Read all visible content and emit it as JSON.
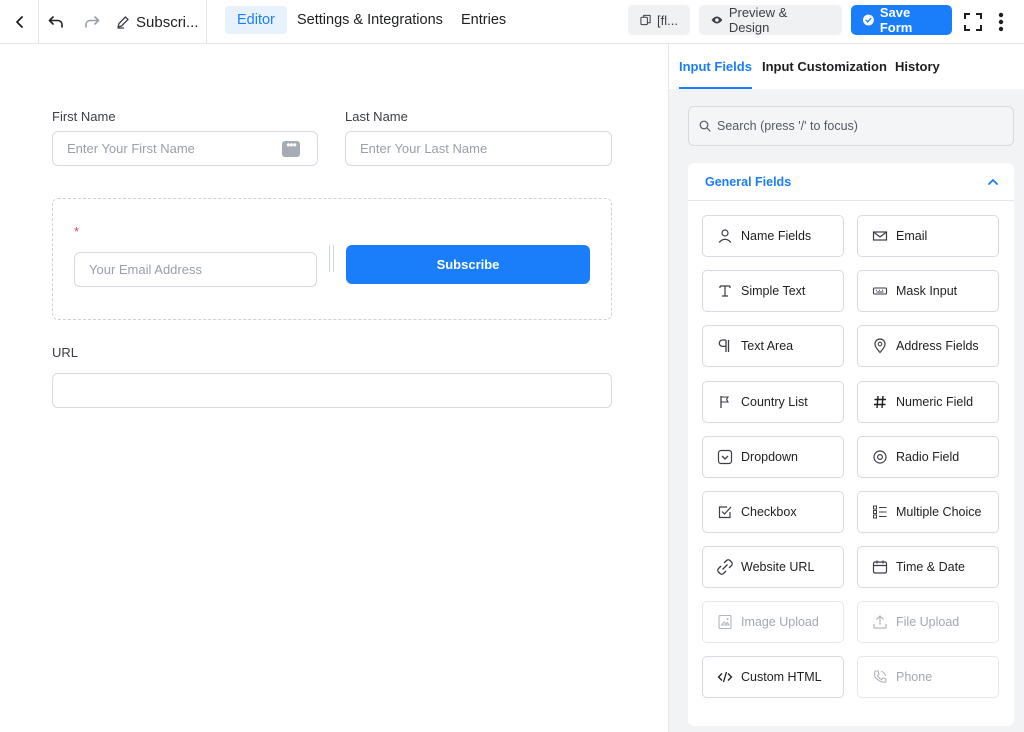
{
  "topbar": {
    "form_title": "Subscri...",
    "tabs": [
      {
        "label": "Editor",
        "active": true
      },
      {
        "label": "Settings & Integrations",
        "active": false
      },
      {
        "label": "Entries",
        "active": false
      }
    ],
    "shortcode_label": "[fl...",
    "preview_label": "Preview & Design",
    "save_label": "Save Form"
  },
  "form": {
    "first_name": {
      "label": "First Name",
      "placeholder": "Enter Your First Name"
    },
    "last_name": {
      "label": "Last Name",
      "placeholder": "Enter Your Last Name"
    },
    "email": {
      "required_mark": "*",
      "placeholder": "Your Email Address"
    },
    "subscribe_label": "Subscribe",
    "url": {
      "label": "URL"
    }
  },
  "sidebar": {
    "tabs": [
      {
        "label": "Input Fields",
        "active": true
      },
      {
        "label": "Input Customization",
        "active": false
      },
      {
        "label": "History",
        "active": false
      }
    ],
    "search_placeholder": "Search (press '/' to focus)",
    "section_title": "General Fields",
    "fields": [
      {
        "label": "Name Fields",
        "icon": "person-icon",
        "enabled": true
      },
      {
        "label": "Email",
        "icon": "envelope-icon",
        "enabled": true
      },
      {
        "label": "Simple Text",
        "icon": "text-cursor-icon",
        "enabled": true
      },
      {
        "label": "Mask Input",
        "icon": "keyboard-icon",
        "enabled": true
      },
      {
        "label": "Text Area",
        "icon": "paragraph-icon",
        "enabled": true
      },
      {
        "label": "Address Fields",
        "icon": "map-pin-icon",
        "enabled": true
      },
      {
        "label": "Country List",
        "icon": "flag-icon",
        "enabled": true
      },
      {
        "label": "Numeric Field",
        "icon": "hash-icon",
        "enabled": true
      },
      {
        "label": "Dropdown",
        "icon": "dropdown-icon",
        "enabled": true
      },
      {
        "label": "Radio Field",
        "icon": "radio-icon",
        "enabled": true
      },
      {
        "label": "Checkbox",
        "icon": "checkbox-icon",
        "enabled": true
      },
      {
        "label": "Multiple Choice",
        "icon": "list-check-icon",
        "enabled": true
      },
      {
        "label": "Website URL",
        "icon": "link-icon",
        "enabled": true
      },
      {
        "label": "Time & Date",
        "icon": "calendar-icon",
        "enabled": true
      },
      {
        "label": "Image Upload",
        "icon": "image-icon",
        "enabled": false
      },
      {
        "label": "File Upload",
        "icon": "upload-icon",
        "enabled": false
      },
      {
        "label": "Custom HTML",
        "icon": "code-icon",
        "enabled": true
      },
      {
        "label": "Phone",
        "icon": "phone-icon",
        "enabled": false
      }
    ]
  },
  "colors": {
    "accent": "#1a7efb",
    "border": "#d6dae1",
    "sidebar_bg": "#f2f3f5"
  }
}
